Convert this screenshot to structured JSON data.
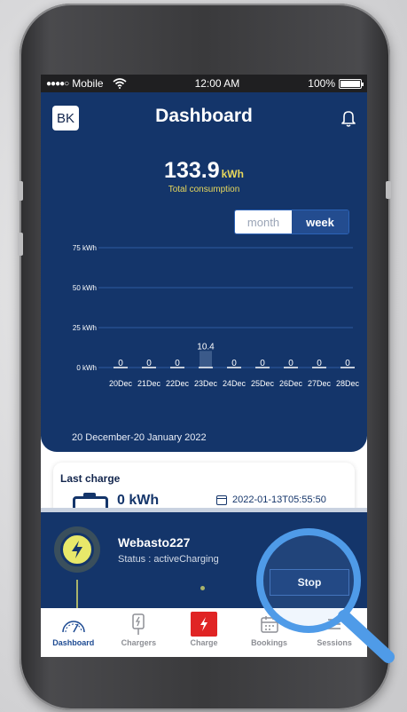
{
  "status_bar": {
    "carrier": "Mobile",
    "signal_dots": "●●●●○",
    "time": "12:00 AM",
    "battery": "100%"
  },
  "header": {
    "avatar": "BK",
    "title": "Dashboard"
  },
  "summary": {
    "total_value": "133.9",
    "total_unit": "kWh",
    "total_label": "Total consumption"
  },
  "period_toggle": {
    "options": [
      "month",
      "week"
    ],
    "selected": "week"
  },
  "chart_data": {
    "type": "bar",
    "categories": [
      "20Dec",
      "21Dec",
      "22Dec",
      "23Dec",
      "24Dec",
      "25Dec",
      "26Dec",
      "27Dec",
      "28Dec"
    ],
    "values": [
      0,
      0,
      0,
      10.4,
      0,
      0,
      0,
      0,
      0
    ],
    "value_labels": [
      "0",
      "0",
      "0",
      "10.4",
      "0",
      "0",
      "0",
      "0",
      "0"
    ],
    "y_ticks": [
      "0 kWh",
      "25 kWh",
      "50 kWh",
      "75 kWh"
    ],
    "ylim": [
      0,
      75
    ],
    "grid": true,
    "colors": {
      "bar": "#3b5a8a",
      "grid": "#2e5aa0",
      "text": "#ffffff"
    }
  },
  "date_range": "20 December-20 January 2022",
  "last_charge": {
    "title": "Last charge",
    "energy": "0 kWh",
    "date": "2022-01-13T05:55:50"
  },
  "active_session": {
    "station": "Webasto227",
    "status": "Status : activeCharging",
    "stop_label": "Stop"
  },
  "tabs": [
    {
      "label": "Dashboard",
      "icon": "gauge-icon",
      "active": true
    },
    {
      "label": "Chargers",
      "icon": "charger-plug-icon",
      "active": false
    },
    {
      "label": "Charge",
      "icon": "bolt-icon",
      "active": false
    },
    {
      "label": "Bookings",
      "icon": "calendar-icon",
      "active": false
    },
    {
      "label": "Sessions",
      "icon": "list-icon",
      "active": false
    }
  ],
  "colors": {
    "primary": "#14356a",
    "accent": "#e8d85c",
    "charge_red": "#e02424",
    "magnifier": "#4f9be8"
  }
}
